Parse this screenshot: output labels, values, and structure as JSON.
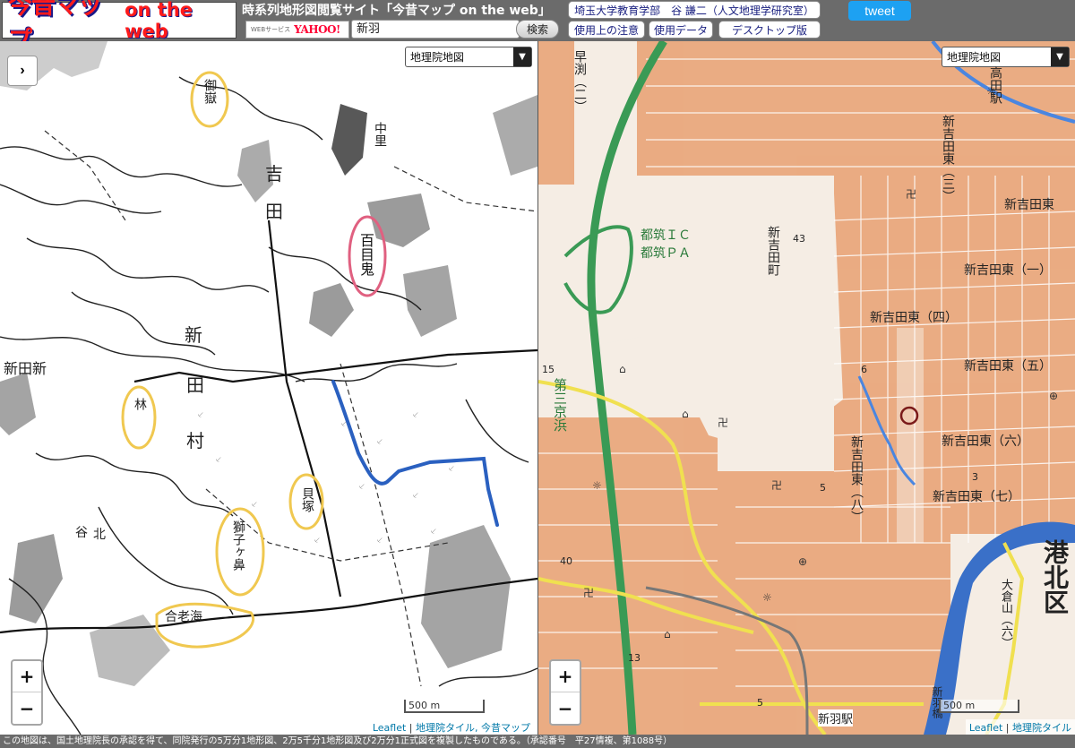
{
  "header": {
    "logo_main": "今昔マップ",
    "logo_sub": "on the web",
    "site_title": "時系列地形図閲覧サイト「今昔マップ on the web」",
    "web_service": "WEBサービス",
    "yahoo": "YAHOO!",
    "search_value": "新羽",
    "search_button": "検索",
    "author_link": "埼玉大学教育学部　谷 謙二（人文地理学研究室）",
    "usage_notes": "使用上の注意",
    "data_used": "使用データ",
    "desktop": "デスクトップ版",
    "tweet": "tweet"
  },
  "left_map": {
    "layer_select": "地理院地図",
    "labels": {
      "momo": "百目鬼",
      "kaizuka": "貝塚",
      "shishiga": "獅子ヶ鼻",
      "okami": "御嶽",
      "kiyomori": "林",
      "shin": "新",
      "ta": "田",
      "mura": "村",
      "yoshi": "吉",
      "ta2": "田",
      "nakazato": "中里",
      "oyamada": "新田新",
      "soko": "谷",
      "hoku": "北",
      "gunken": "合老海"
    },
    "scale": "500 m",
    "attribution_leaflet": "Leaflet",
    "attribution_sep": "|",
    "attribution_tiles": "地理院タイル, 今昔マップ"
  },
  "right_map": {
    "layer_select": "地理院地図",
    "labels": {
      "takata_station": "高田駅",
      "shinyoshida_higashi_3": "新吉田東（三）",
      "shinyoshida_higashi_top": "新吉田東",
      "shinyoshida_higashi_1": "新吉田東（一）",
      "shinyoshida_higashi_4": "新吉田東（四）",
      "shinyoshida_higashi_5": "新吉田東（五）",
      "shinyoshida_higashi_6": "新吉田東（六）",
      "shinyoshida_higashi_7": "新吉田東（七）",
      "shinyoshida_higashi_8": "新吉田東（八）",
      "shinyoshida_cho": "新吉田町",
      "tsuzuki_ic": "都筑ＩＣ",
      "tsuzuki_pa": "都筑ＰＡ",
      "sayabuchi": "早渕（二）",
      "daisan_keihin": "第三京浜",
      "kohoku_ku": "港北区",
      "okurayama": "大倉山（六）",
      "nippa_station": "新羽駅",
      "nippa_bridge": "新羽橋",
      "elev_43": "43",
      "elev_15": "15",
      "elev_6": "6",
      "elev_5a": "5",
      "elev_5b": "5",
      "elev_40": "40",
      "elev_13": "13",
      "elev_3": "3"
    },
    "scale": "500 m",
    "attribution_leaflet": "Leaflet",
    "attribution_sep": "|",
    "attribution_tiles": "地理院タイル"
  },
  "controls": {
    "zoom_in": "+",
    "zoom_out": "−",
    "sidebar_toggle": "›",
    "dropdown_arrow": "▼"
  },
  "footer": {
    "text": "この地図は、国土地理院長の承認を得て、同院発行の5万分1地形図、2万5千分1地形図及び2万分1正式図を複製したものである。（承認番号　平27情複、第1088号）"
  },
  "colors": {
    "header_bg": "#6b6b6b",
    "tweet": "#1da1f2",
    "highway": "#3a9a55",
    "river": "#3a70c8",
    "road_yellow": "#f0e050",
    "urban_orange": "#e8a070",
    "annotation_red": "#e06080",
    "annotation_yellow": "#f0c850",
    "annotation_blue": "#2a60c0"
  }
}
